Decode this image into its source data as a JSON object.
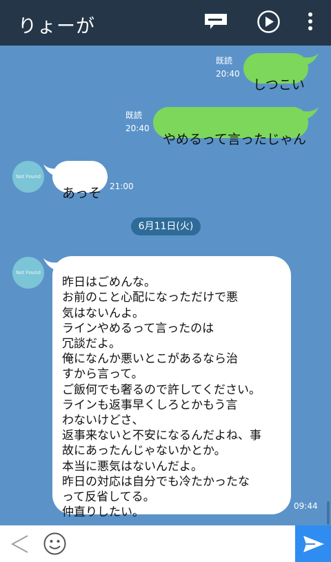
{
  "header": {
    "title": "りょーが",
    "icons": [
      "note-icon",
      "play-icon",
      "more-vert-icon"
    ]
  },
  "messages": {
    "m1": {
      "text": "しつこい",
      "read": "既読",
      "time": "20:40"
    },
    "m2": {
      "text": "やめるって言ったじゃん",
      "read": "既読",
      "time": "20:40"
    },
    "m3": {
      "text": "あっそ",
      "time": "21:00",
      "avatar": "Not Found"
    },
    "date_separator": "6月11日(火)",
    "m4": {
      "avatar": "Not Found",
      "text": "昨日はごめんな。\nお前のこと心配になっただけで悪\n気はないんよ。\nラインやめるって言ったのは\n冗談だよ。\n俺になんか悪いとこがあるなら治\nすから言って。\nご飯何でも奢るので許してください。\nラインも返事早くしろとかもう言\nわないけどさ、\n返事来ないと不安になるんだよね、事\n故にあったんじゃないかとか。\n本当に悪気はないんだよ。\n昨日の対応は自分でも冷たかったな\nって反省してる。\n仲直りしたい。",
      "time": "09:44"
    }
  },
  "colors": {
    "header_bg": "#253648",
    "chat_bg": "#5b93c9",
    "sent_bubble": "#7dd75b",
    "received_bubble": "#ffffff",
    "send_button": "#2f8cf0"
  },
  "input_bar": {
    "icons": [
      "back-chevron-icon",
      "smiley-icon",
      "send-icon"
    ]
  }
}
